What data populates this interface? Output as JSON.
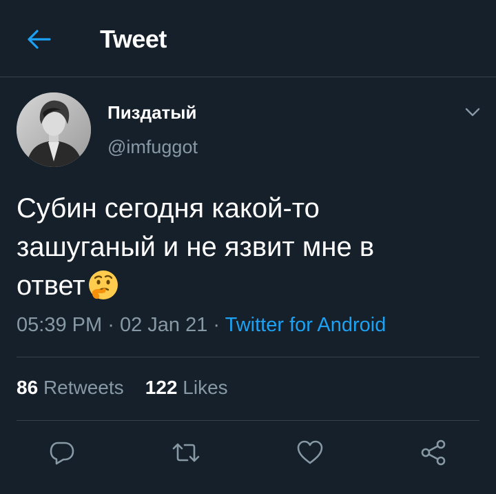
{
  "header": {
    "title": "Tweet",
    "back_icon": "arrow-left-icon"
  },
  "author": {
    "display_name": "Пиздатый",
    "username": "@imfuggot"
  },
  "tweet": {
    "text": "Субин сегодня какой-то\nзашуганый и не язвит мне в\nответ",
    "emoji": "thinking-face-emoji",
    "time": "05:39 PM",
    "date": "02 Jan 21",
    "separator": "·",
    "source": "Twitter for Android"
  },
  "stats": {
    "retweets_count": "86",
    "retweets_label": "Retweets",
    "likes_count": "122",
    "likes_label": "Likes"
  },
  "actions": [
    "reply-icon",
    "retweet-icon",
    "like-icon",
    "share-icon"
  ],
  "colors": {
    "background": "#15202b",
    "accent": "#1da1f2",
    "secondary_text": "#8899a6",
    "divider": "#38444d"
  }
}
